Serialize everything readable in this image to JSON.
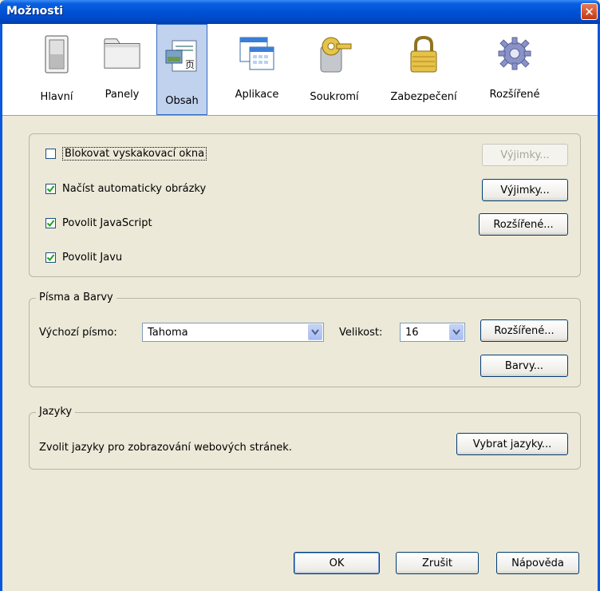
{
  "window": {
    "title": "Možnosti"
  },
  "toolbar": {
    "items": [
      {
        "label": "Hlavní",
        "icon": "switch-icon"
      },
      {
        "label": "Panely",
        "icon": "folder-tab-icon"
      },
      {
        "label": "Obsah",
        "icon": "document-icon",
        "active": true
      },
      {
        "label": "Aplikace",
        "icon": "window-grid-icon"
      },
      {
        "label": "Soukromí",
        "icon": "key-icon"
      },
      {
        "label": "Zabezpečení",
        "icon": "padlock-icon"
      },
      {
        "label": "Rozšířené",
        "icon": "gear-icon"
      }
    ]
  },
  "content": {
    "block_popups": {
      "label": "Blokovat vyskakovací okna",
      "checked": false,
      "button": "Výjimky..."
    },
    "load_images": {
      "label": "Načíst automaticky obrázky",
      "checked": true,
      "button": "Výjimky..."
    },
    "javascript": {
      "label": "Povolit JavaScript",
      "checked": true,
      "button": "Rozšířené..."
    },
    "java": {
      "label": "Povolit Javu",
      "checked": true
    }
  },
  "fonts": {
    "legend": "Písma a Barvy",
    "default_font_label": "Výchozí písmo:",
    "default_font_value": "Tahoma",
    "size_label": "Velikost:",
    "size_value": "16",
    "advanced_button": "Rozšířené...",
    "colors_button": "Barvy..."
  },
  "languages": {
    "legend": "Jazyky",
    "description": "Zvolit jazyky pro zobrazování webových stránek.",
    "choose_button": "Vybrat jazyky..."
  },
  "footer": {
    "ok": "OK",
    "cancel": "Zrušit",
    "help": "Nápověda"
  }
}
